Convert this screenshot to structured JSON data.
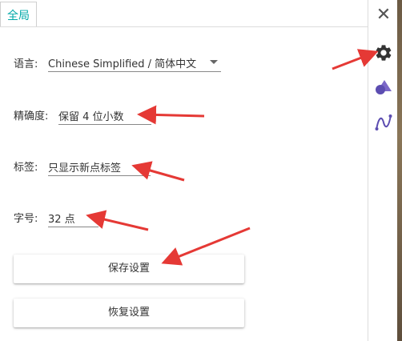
{
  "tab": {
    "label": "全局"
  },
  "settings": {
    "language": {
      "label": "语言:",
      "value": "Chinese Simplified / 简体中文"
    },
    "rounding": {
      "label": "精确度:",
      "value": "保留 4 位小数"
    },
    "labeling": {
      "label": "标签:",
      "value": "只显示新点标签"
    },
    "font_size": {
      "label": "字号:",
      "value": "32 点"
    }
  },
  "buttons": {
    "save": "保存设置",
    "restore": "恢复设置"
  },
  "sidebar": {
    "icons": [
      "gear-icon",
      "geometry-shapes-icon",
      "function-graph-icon"
    ]
  },
  "colors": {
    "accent": "#00a8a8",
    "annotation_arrow": "#e53935"
  }
}
